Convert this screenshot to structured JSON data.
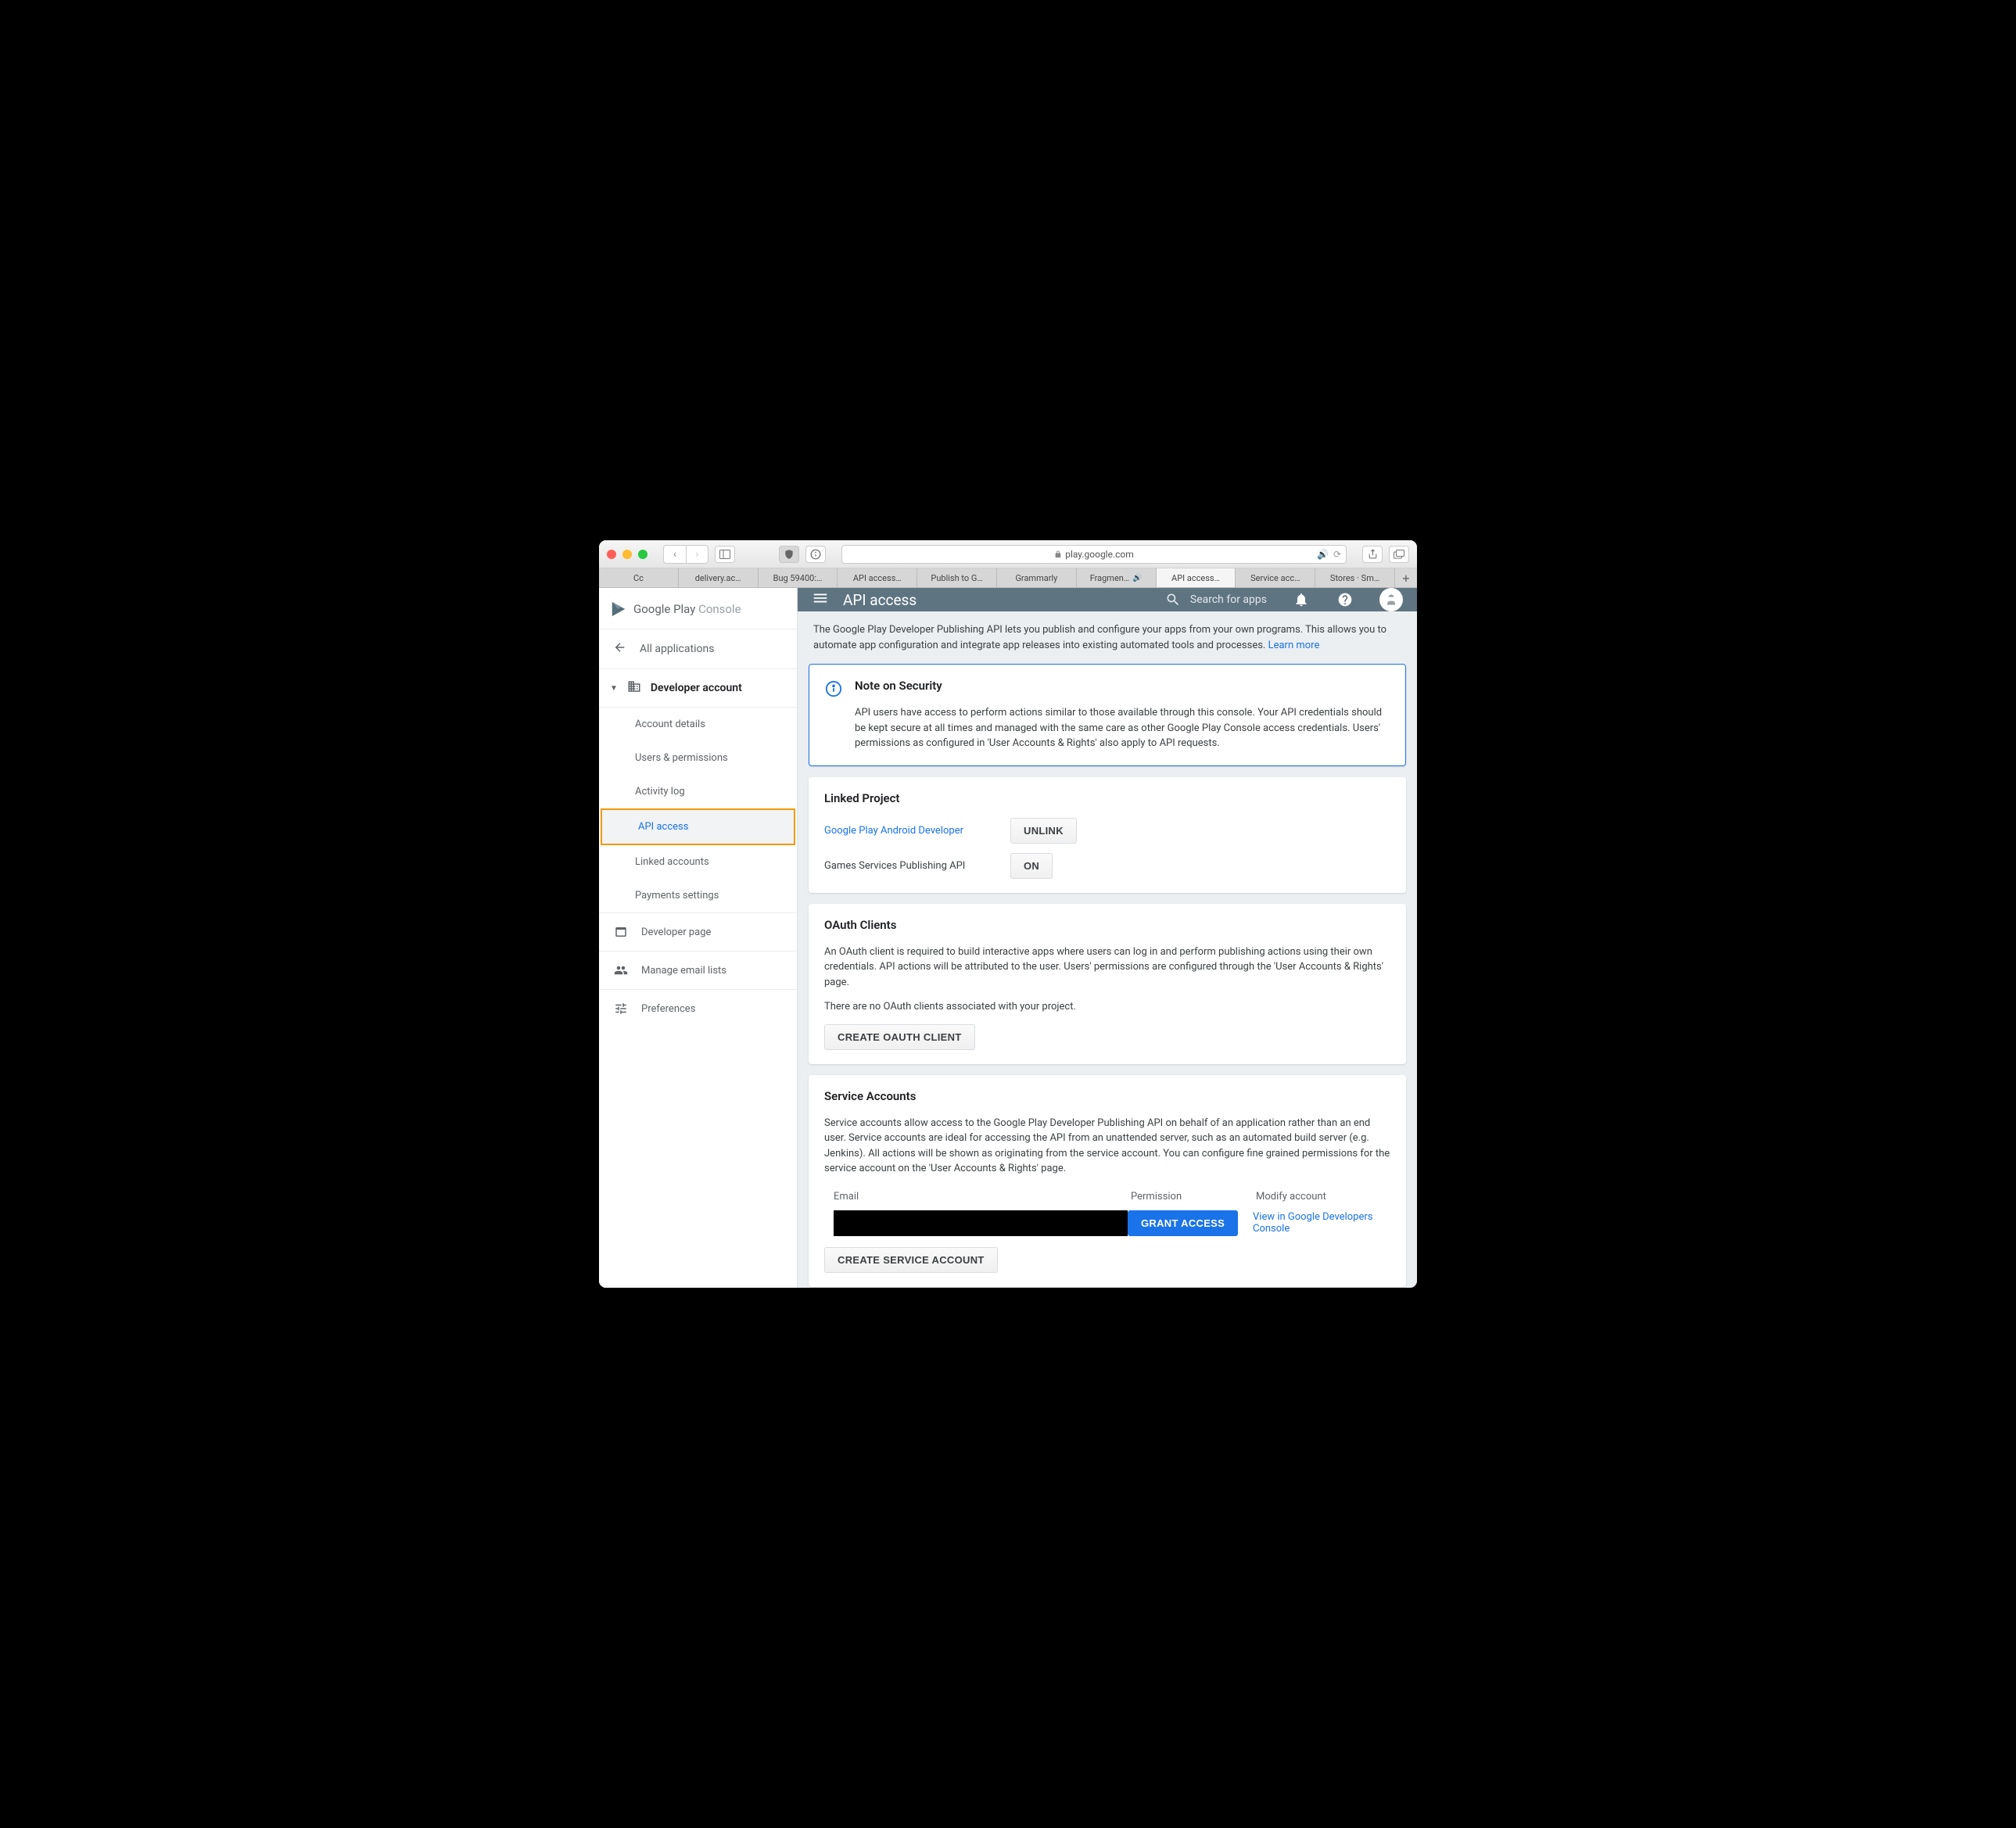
{
  "browser": {
    "url_host": "play.google.com",
    "tabs": [
      {
        "label": "Cc"
      },
      {
        "label": "delivery.ac…"
      },
      {
        "label": "Bug 59400:…"
      },
      {
        "label": "API access…"
      },
      {
        "label": "Publish to G…"
      },
      {
        "label": "Grammarly"
      },
      {
        "label": "Fragmen…",
        "sound": true
      },
      {
        "label": "API access…",
        "active": true
      },
      {
        "label": "Service acc…"
      },
      {
        "label": "Stores · Sm…"
      }
    ]
  },
  "sidebar": {
    "brand_a": "Google Play",
    "brand_b": "Console",
    "all_apps": "All applications",
    "dev_account": "Developer account",
    "items": [
      {
        "label": "Account details"
      },
      {
        "label": "Users & permissions"
      },
      {
        "label": "Activity log"
      },
      {
        "label": "API access",
        "active": true
      },
      {
        "label": "Linked accounts"
      },
      {
        "label": "Payments settings"
      }
    ],
    "dev_page": "Developer page",
    "manage_email": "Manage email lists",
    "preferences": "Preferences"
  },
  "appbar": {
    "title": "API access",
    "search_placeholder": "Search for apps"
  },
  "intro": {
    "text": "The Google Play Developer Publishing API lets you publish and configure your apps from your own programs. This allows you to automate app configuration and integrate app releases into existing automated tools and processes.",
    "learn_more": "Learn more"
  },
  "note": {
    "title": "Note on Security",
    "body": "API users have access to perform actions similar to those available through this console. Your API credentials should be kept secure at all times and managed with the same care as other Google Play Console access credentials. Users' permissions as configured in 'User Accounts & Rights' also apply to API requests."
  },
  "linked": {
    "title": "Linked Project",
    "row1_label": "Google Play Android Developer",
    "row1_btn": "Unlink",
    "row2_label": "Games Services Publishing API",
    "row2_btn": "On"
  },
  "oauth": {
    "title": "OAuth Clients",
    "desc": "An OAuth client is required to build interactive apps where users can log in and perform publishing actions using their own credentials. API actions will be attributed to the user. Users' permissions are configured through the 'User Accounts & Rights' page.",
    "empty": "There are no OAuth clients associated with your project.",
    "create_btn": "Create OAuth Client"
  },
  "service": {
    "title": "Service Accounts",
    "desc": "Service accounts allow access to the Google Play Developer Publishing API on behalf of an application rather than an end user. Service accounts are ideal for accessing the API from an unattended server, such as an automated build server (e.g. Jenkins). All actions will be shown as originating from the service account. You can configure fine grained permissions for the service account on the 'User Accounts & Rights' page.",
    "col_email": "Email",
    "col_permission": "Permission",
    "col_modify": "Modify account",
    "grant_btn": "Grant Access",
    "view_link": "View in Google Developers Console",
    "create_btn": "Create Service Account"
  }
}
